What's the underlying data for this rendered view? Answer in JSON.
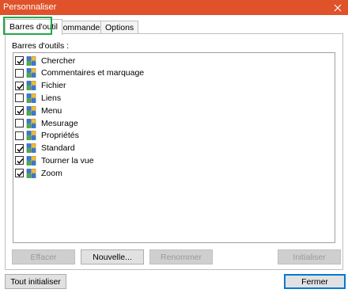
{
  "window": {
    "title": "Personnaliser"
  },
  "tabs": [
    {
      "label": "Barres d'outil",
      "active": true
    },
    {
      "label": "Commandes",
      "active": false
    },
    {
      "label": "Options",
      "active": false
    }
  ],
  "panel": {
    "label": "Barres d'outils :"
  },
  "toolbars": [
    {
      "label": "Chercher",
      "checked": true
    },
    {
      "label": "Commentaires et marquage",
      "checked": false
    },
    {
      "label": "Fichier",
      "checked": true
    },
    {
      "label": "Liens",
      "checked": false
    },
    {
      "label": "Menu",
      "checked": true
    },
    {
      "label": "Mesurage",
      "checked": false
    },
    {
      "label": "Propriétés",
      "checked": false
    },
    {
      "label": "Standard",
      "checked": true
    },
    {
      "label": "Tourner la vue",
      "checked": true
    },
    {
      "label": "Zoom",
      "checked": true
    }
  ],
  "buttons": {
    "clear": "Effacer",
    "new": "Nouvelle...",
    "rename": "Renommer",
    "reset": "Initialiser",
    "reset_all": "Tout initialiser",
    "close": "Fermer"
  },
  "colors": {
    "titlebar": "#e0522a",
    "highlight": "#22a84a",
    "default_button_border": "#0078d7"
  },
  "icons": {
    "close": "close-icon",
    "toolbar": "toolbar-icon",
    "check": "check-icon"
  }
}
